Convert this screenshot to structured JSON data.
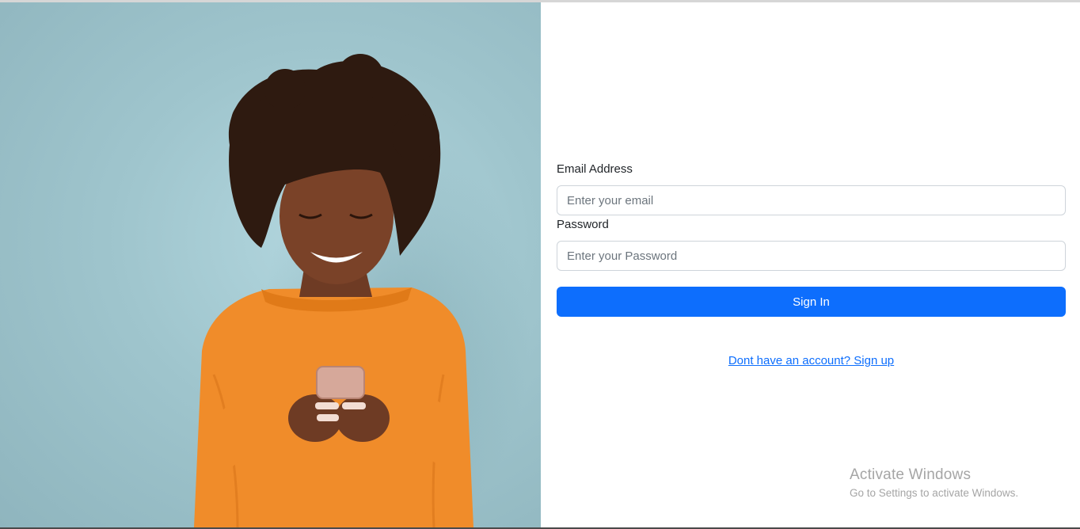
{
  "hero": {
    "image_description_icon": "person-with-phone-photo"
  },
  "form": {
    "email_label": "Email Address",
    "email_placeholder": "Enter your email",
    "email_value": "",
    "password_label": "Password",
    "password_placeholder": "Enter your Password",
    "password_value": "",
    "submit_label": "Sign In",
    "signup_link": "Dont have an account? Sign up"
  },
  "watermark": {
    "title": "Activate Windows",
    "subtitle": "Go to Settings to activate Windows."
  },
  "colors": {
    "primary": "#0d6efd",
    "hero_bg": "#9fc5cd",
    "sweater": "#f08c2a"
  }
}
